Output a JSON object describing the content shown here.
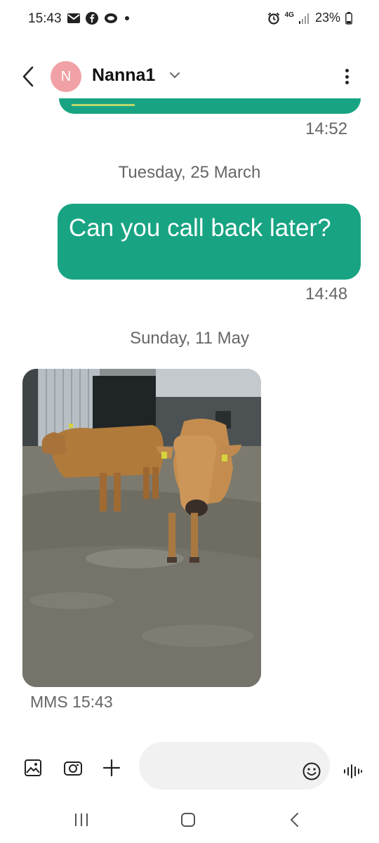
{
  "status_bar": {
    "time": "15:43",
    "left_icons": [
      "email-icon",
      "facebook-icon",
      "chat-bubble-icon",
      "notification-dot-icon"
    ],
    "right_icons": [
      "alarm-icon",
      "4g-icon",
      "signal-icon",
      "battery-icon"
    ],
    "network": "4G",
    "battery": "23%"
  },
  "header": {
    "avatar_letter": "N",
    "avatar_color": "#f1a1a6",
    "contact_name": "Nanna1"
  },
  "messages": {
    "first_time": "14:52",
    "date_1": "Tuesday, 25 March",
    "outgoing_text": "Can you call back later?",
    "outgoing_time": "14:48",
    "date_2": "Sunday, 11 May",
    "mms_meta": "MMS 15:43"
  },
  "composer": {
    "placeholder": ""
  },
  "colors": {
    "bubble": "#18a483",
    "date_text": "#666666"
  }
}
